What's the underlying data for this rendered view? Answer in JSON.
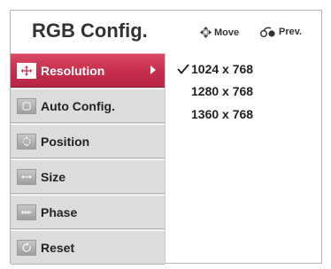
{
  "header": {
    "title": "RGB Config.",
    "hint_move": "Move",
    "hint_prev": "Prev."
  },
  "menu": {
    "items": [
      {
        "label": "Resolution",
        "icon": "resolution-icon",
        "selected": true
      },
      {
        "label": "Auto Config.",
        "icon": "auto-config-icon"
      },
      {
        "label": "Position",
        "icon": "position-icon"
      },
      {
        "label": "Size",
        "icon": "size-icon"
      },
      {
        "label": "Phase",
        "icon": "phase-icon"
      },
      {
        "label": "Reset",
        "icon": "reset-icon"
      }
    ]
  },
  "options": {
    "items": [
      {
        "label": "1024 x 768",
        "checked": true
      },
      {
        "label": "1280 x 768"
      },
      {
        "label": "1360 x 768"
      }
    ]
  },
  "colors": {
    "selected": "#c72f4d",
    "menu_bg": "#dcdcdc",
    "text": "#222222"
  }
}
